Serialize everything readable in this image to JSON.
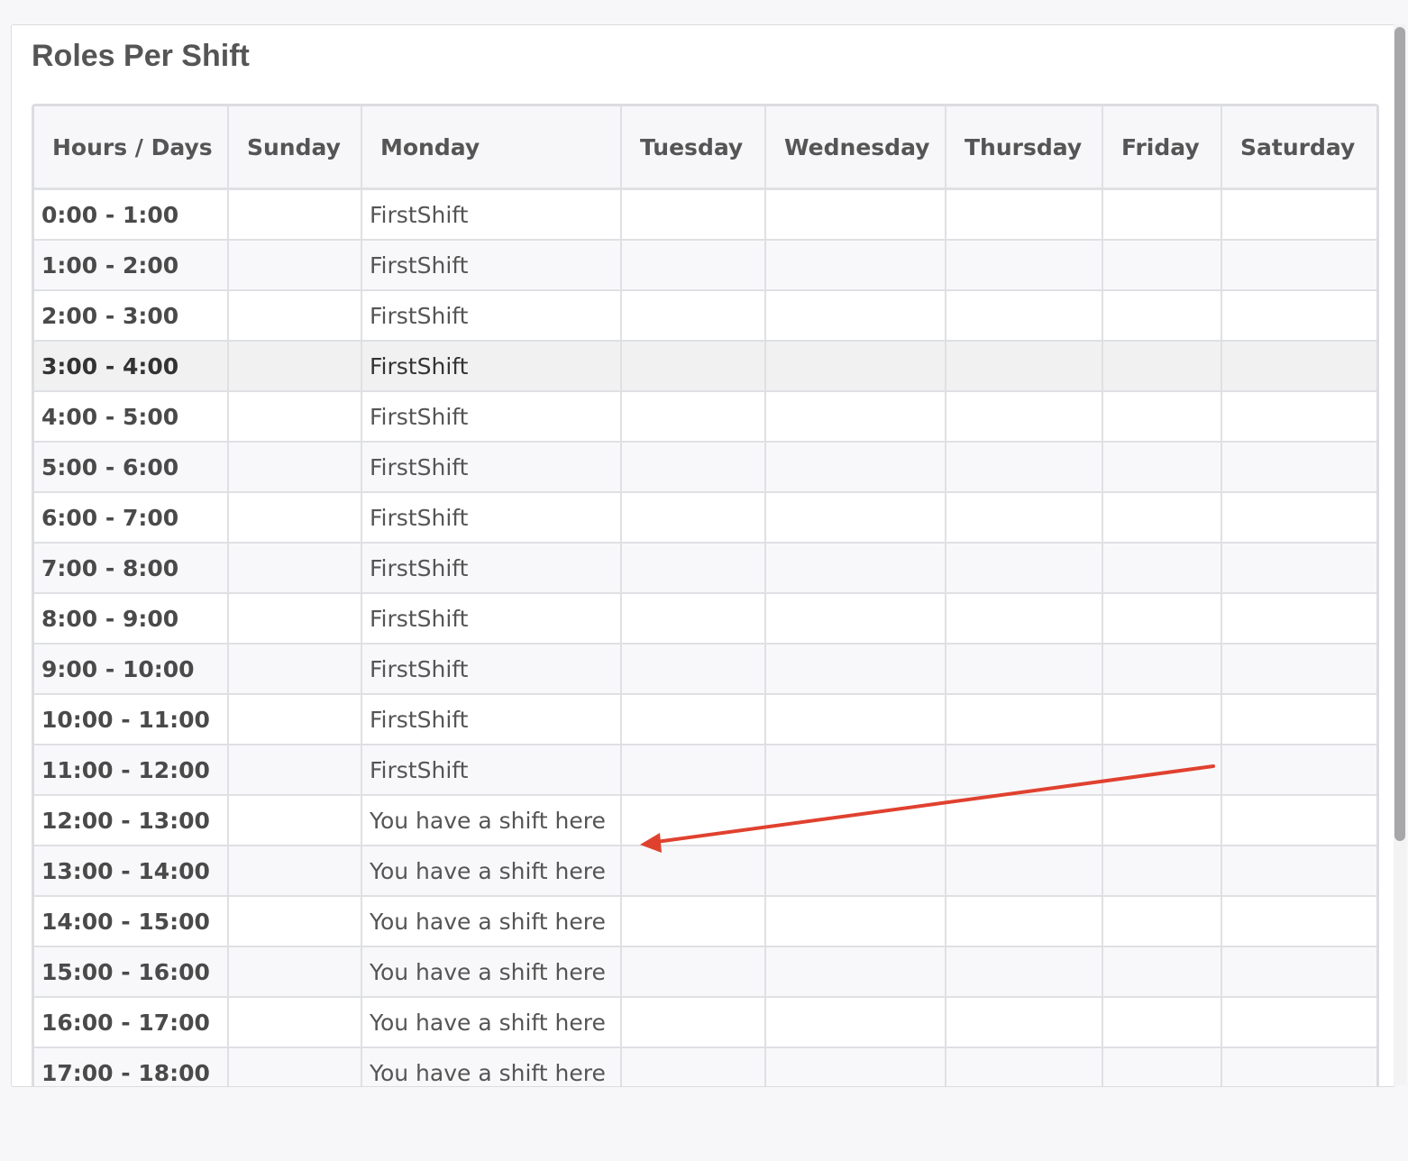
{
  "title": "Roles Per Shift",
  "columns": [
    "Hours / Days",
    "Sunday",
    "Monday",
    "Tuesday",
    "Wednesday",
    "Thursday",
    "Friday",
    "Saturday"
  ],
  "rows": [
    {
      "hour": "0:00 - 1:00",
      "cells": [
        "",
        "FirstShift",
        "",
        "",
        "",
        "",
        ""
      ]
    },
    {
      "hour": "1:00 - 2:00",
      "cells": [
        "",
        "FirstShift",
        "",
        "",
        "",
        "",
        ""
      ]
    },
    {
      "hour": "2:00 - 3:00",
      "cells": [
        "",
        "FirstShift",
        "",
        "",
        "",
        "",
        ""
      ]
    },
    {
      "hour": "3:00 - 4:00",
      "cells": [
        "",
        "FirstShift",
        "",
        "",
        "",
        "",
        ""
      ],
      "highlighted": true
    },
    {
      "hour": "4:00 - 5:00",
      "cells": [
        "",
        "FirstShift",
        "",
        "",
        "",
        "",
        ""
      ]
    },
    {
      "hour": "5:00 - 6:00",
      "cells": [
        "",
        "FirstShift",
        "",
        "",
        "",
        "",
        ""
      ]
    },
    {
      "hour": "6:00 - 7:00",
      "cells": [
        "",
        "FirstShift",
        "",
        "",
        "",
        "",
        ""
      ]
    },
    {
      "hour": "7:00 - 8:00",
      "cells": [
        "",
        "FirstShift",
        "",
        "",
        "",
        "",
        ""
      ]
    },
    {
      "hour": "8:00 - 9:00",
      "cells": [
        "",
        "FirstShift",
        "",
        "",
        "",
        "",
        ""
      ]
    },
    {
      "hour": "9:00 - 10:00",
      "cells": [
        "",
        "FirstShift",
        "",
        "",
        "",
        "",
        ""
      ]
    },
    {
      "hour": "10:00 - 11:00",
      "cells": [
        "",
        "FirstShift",
        "",
        "",
        "",
        "",
        ""
      ]
    },
    {
      "hour": "11:00 - 12:00",
      "cells": [
        "",
        "FirstShift",
        "",
        "",
        "",
        "",
        ""
      ]
    },
    {
      "hour": "12:00 - 13:00",
      "cells": [
        "",
        "You have a shift here",
        "",
        "",
        "",
        "",
        ""
      ]
    },
    {
      "hour": "13:00 - 14:00",
      "cells": [
        "",
        "You have a shift here",
        "",
        "",
        "",
        "",
        ""
      ]
    },
    {
      "hour": "14:00 - 15:00",
      "cells": [
        "",
        "You have a shift here",
        "",
        "",
        "",
        "",
        ""
      ]
    },
    {
      "hour": "15:00 - 16:00",
      "cells": [
        "",
        "You have a shift here",
        "",
        "",
        "",
        "",
        ""
      ]
    },
    {
      "hour": "16:00 - 17:00",
      "cells": [
        "",
        "You have a shift here",
        "",
        "",
        "",
        "",
        ""
      ]
    },
    {
      "hour": "17:00 - 18:00",
      "cells": [
        "",
        "You have a shift here",
        "",
        "",
        "",
        "",
        ""
      ]
    }
  ],
  "colors": {
    "annotation_arrow": "#e0412f",
    "border": "#dfe0e3",
    "header_bg": "#f7f7f9",
    "text": "#555555"
  }
}
